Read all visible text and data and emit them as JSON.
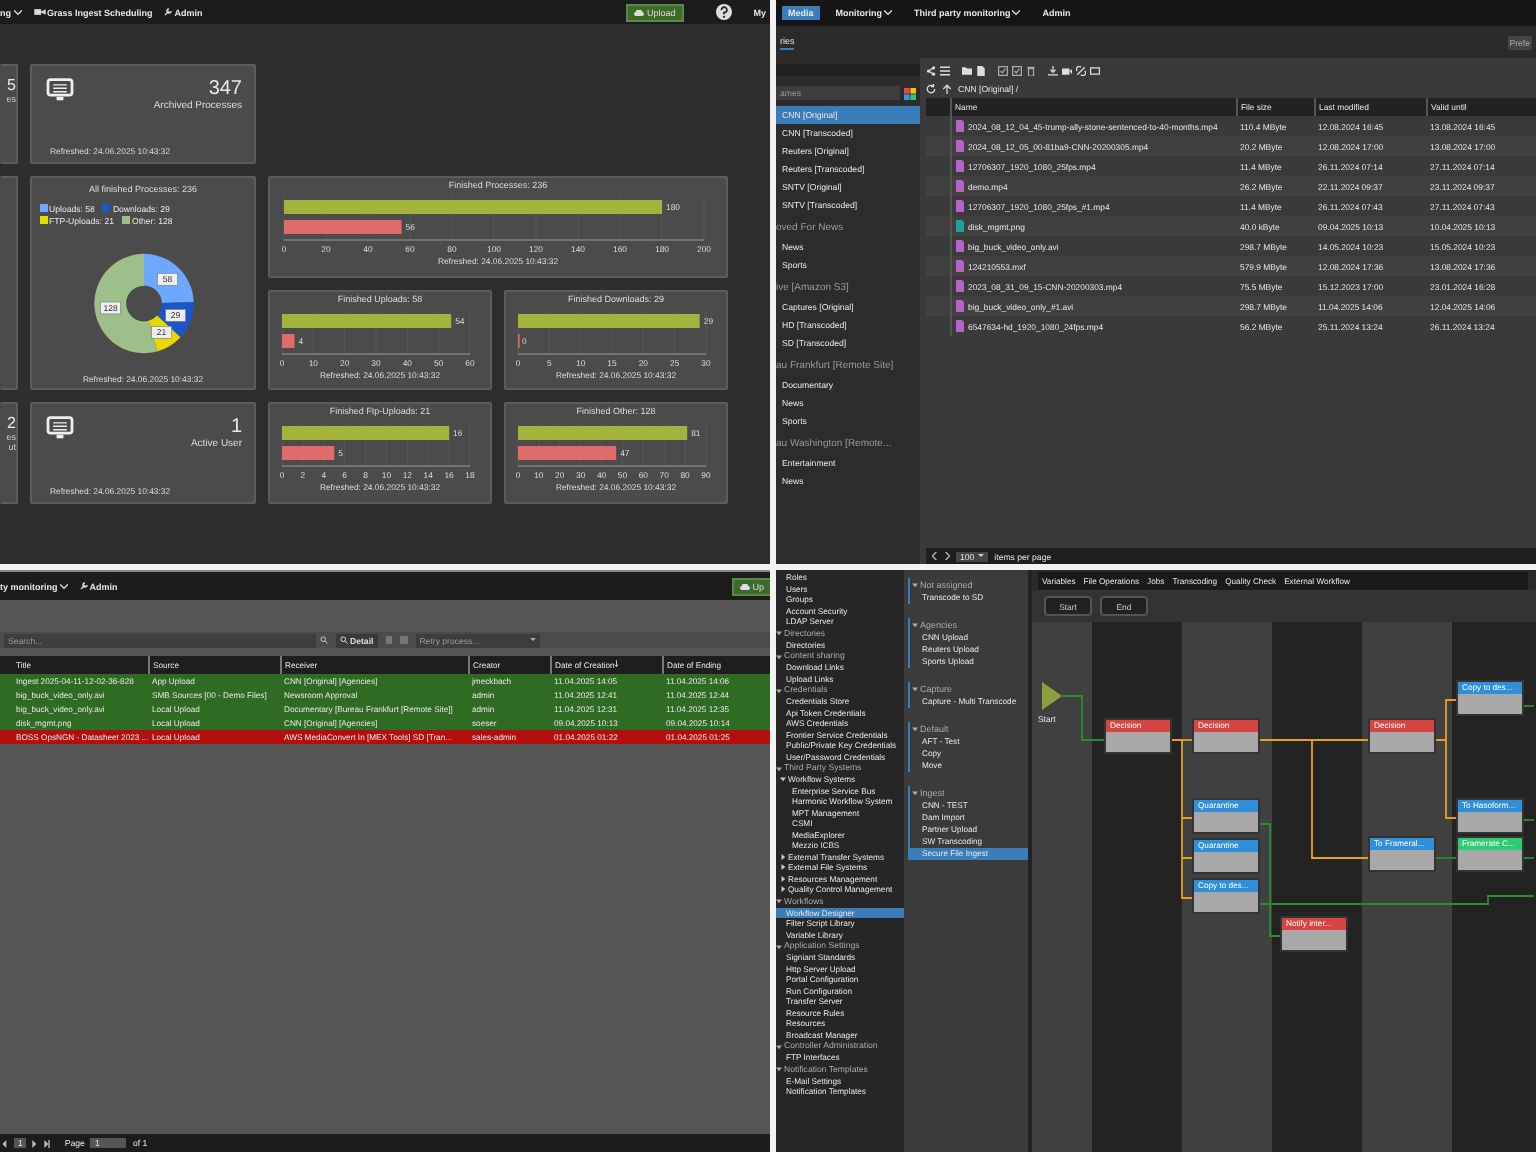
{
  "dashboard": {
    "nav": [
      {
        "label": "ng",
        "caret": true,
        "icon": false
      },
      {
        "label": "Grass Ingest Scheduling",
        "caret": false,
        "icon": true
      },
      {
        "label": "Admin",
        "caret": false,
        "icon": true
      }
    ],
    "upload_button": "Upload",
    "user_menu": "My",
    "partial_cards": [
      {
        "value": "5",
        "label": "es"
      },
      {
        "value": "2",
        "label": "es",
        "extra": "ut"
      }
    ],
    "stat_cards": [
      {
        "value": "347",
        "label": "Archived Processes",
        "refreshed": "Refreshed: 24.06.2025 10:43:32"
      },
      {
        "value": "1",
        "label": "Active User",
        "refreshed": "Refreshed: 24.06.2025 10:43:32"
      }
    ],
    "donut_card": {
      "refreshed": "Refreshed: 24.06.2025 10:43:32",
      "chart_data": {
        "type": "donut",
        "title": "All finished Processes: 236",
        "categories": [
          "Uploads: 58",
          "Downloads: 29",
          "FTP-Uploads: 21",
          "Other: 128"
        ],
        "values": [
          58,
          29,
          21,
          128
        ],
        "colors": [
          "#6ea8fe",
          "#1a56c9",
          "#e6d800",
          "#9dc08b"
        ],
        "data_labels": true
      }
    },
    "bar_cards": [
      {
        "refreshed": "Refreshed: 24.06.2025 10:43:32",
        "chart_data": {
          "type": "bar",
          "orientation": "horizontal",
          "title": "Finished Processes: 236",
          "series": [
            {
              "color": "#a2b23c",
              "values": [
                180
              ]
            },
            {
              "color": "#e06b6b",
              "values": [
                56
              ]
            }
          ],
          "xlim": [
            0,
            200
          ],
          "xticks": [
            0,
            20,
            40,
            60,
            80,
            100,
            120,
            140,
            160,
            180,
            200
          ],
          "grid": true,
          "data_labels": true
        }
      },
      {
        "refreshed": "Refreshed: 24.06.2025 10:43:32",
        "chart_data": {
          "type": "bar",
          "orientation": "horizontal",
          "title": "Finished Uploads: 58",
          "series": [
            {
              "color": "#a2b23c",
              "values": [
                54
              ]
            },
            {
              "color": "#e06b6b",
              "values": [
                4
              ]
            }
          ],
          "xlim": [
            0,
            60
          ],
          "xticks": [
            0,
            10,
            20,
            30,
            40,
            50,
            60
          ],
          "grid": true,
          "data_labels": true
        }
      },
      {
        "refreshed": "Refreshed: 24.06.2025 10:43:32",
        "chart_data": {
          "type": "bar",
          "orientation": "horizontal",
          "title": "Finished Downloads: 29",
          "series": [
            {
              "color": "#a2b23c",
              "values": [
                29
              ]
            },
            {
              "color": "#e06b6b",
              "values": [
                0
              ]
            }
          ],
          "xlim": [
            0,
            30
          ],
          "xticks": [
            0,
            5,
            10,
            15,
            20,
            25,
            30
          ],
          "grid": true,
          "data_labels": true
        }
      },
      {
        "refreshed": "Refreshed: 24.06.2025 10:43:32",
        "chart_data": {
          "type": "bar",
          "orientation": "horizontal",
          "title": "Finished Ftp-Uploads: 21",
          "series": [
            {
              "color": "#a2b23c",
              "values": [
                16
              ]
            },
            {
              "color": "#e06b6b",
              "values": [
                5
              ]
            }
          ],
          "xlim": [
            0,
            18
          ],
          "xticks": [
            0,
            2,
            4,
            6,
            8,
            10,
            12,
            14,
            16,
            18
          ],
          "grid": true,
          "data_labels": true
        }
      },
      {
        "refreshed": "Refreshed: 24.06.2025 10:43:32",
        "chart_data": {
          "type": "bar",
          "orientation": "horizontal",
          "title": "Finished Other: 128",
          "series": [
            {
              "color": "#a2b23c",
              "values": [
                81
              ]
            },
            {
              "color": "#e06b6b",
              "values": [
                47
              ]
            }
          ],
          "xlim": [
            0,
            90
          ],
          "xticks": [
            0,
            10,
            20,
            30,
            40,
            50,
            60,
            70,
            80,
            90
          ],
          "grid": true,
          "data_labels": true
        }
      }
    ]
  },
  "media": {
    "nav": [
      {
        "label": "Media",
        "selected": true,
        "caret": false
      },
      {
        "label": "Monitoring",
        "selected": false,
        "caret": true
      },
      {
        "label": "Third party monitoring",
        "selected": false,
        "caret": true
      },
      {
        "label": "Admin",
        "selected": false,
        "caret": false
      }
    ],
    "section_tab": "ries",
    "section_action": "Prefe",
    "search_placeholder": "ames",
    "groups": [
      {
        "items": [
          {
            "label": "CNN [Original]",
            "selected": true
          },
          {
            "label": "CNN [Transcoded]",
            "selected": false
          },
          {
            "label": "Reuters [Original]",
            "selected": false
          },
          {
            "label": "Reuters [Transcoded]",
            "selected": false
          },
          {
            "label": "SNTV [Original]",
            "selected": false
          },
          {
            "label": "SNTV [Transcoded]",
            "selected": false
          }
        ]
      },
      {
        "title": "oved For News",
        "items": [
          {
            "label": "News",
            "selected": false
          },
          {
            "label": "Sports",
            "selected": false
          }
        ]
      },
      {
        "title": "ive [Amazon S3]",
        "items": [
          {
            "label": "Captures [Original]",
            "selected": false
          },
          {
            "label": "HD [Transcoded]",
            "selected": false
          },
          {
            "label": "SD [Transcoded]",
            "selected": false
          }
        ]
      },
      {
        "title": "au Frankfurt [Remote Site]",
        "items": [
          {
            "label": "Documentary",
            "selected": false
          },
          {
            "label": "News",
            "selected": false
          },
          {
            "label": "Sports",
            "selected": false
          }
        ]
      },
      {
        "title": "au Washington [Remote...",
        "items": [
          {
            "label": "Entertainment",
            "selected": false
          },
          {
            "label": "News",
            "selected": false
          }
        ]
      }
    ],
    "breadcrumb": "CNN [Original] /",
    "columns": [
      "Name",
      "File size",
      "Last modified",
      "Valid until"
    ],
    "rows": [
      {
        "kind": "video",
        "cells": [
          "2024_08_12_04_45-trump-ally-stone-sentenced-to-40-months.mp4",
          "110.4 MByte",
          "12.08.2024 16:45",
          "13.08.2024 16:45"
        ]
      },
      {
        "kind": "video",
        "cells": [
          "2024_08_12_05_00-81ba9-CNN-20200305.mp4",
          "20.2 MByte",
          "12.08.2024 17:00",
          "13.08.2024 17:00"
        ]
      },
      {
        "kind": "video",
        "cells": [
          "12706307_1920_1080_25fps.mp4",
          "11.4 MByte",
          "26.11.2024 07:14",
          "27.11.2024 07:14"
        ]
      },
      {
        "kind": "video",
        "cells": [
          "demo.mp4",
          "26.2 MByte",
          "22.11.2024 09:37",
          "23.11.2024 09:37"
        ]
      },
      {
        "kind": "video",
        "cells": [
          "12706307_1920_1080_25fps_#1.mp4",
          "11.4 MByte",
          "26.11.2024 07:43",
          "27.11.2024 07:43"
        ]
      },
      {
        "kind": "image",
        "cells": [
          "disk_mgmt.png",
          "40.0 kByte",
          "09.04.2025 10:13",
          "10.04.2025 10:13"
        ]
      },
      {
        "kind": "video",
        "cells": [
          "big_buck_video_only.avi",
          "298.7 MByte",
          "14.05.2024 10:23",
          "15.05.2024 10:23"
        ]
      },
      {
        "kind": "video",
        "cells": [
          "124210553.mxf",
          "579.9 MByte",
          "12.08.2024 17:36",
          "13.08.2024 17:36"
        ]
      },
      {
        "kind": "video",
        "cells": [
          "2023_08_31_09_15-CNN-20200303.mp4",
          "75.5 MByte",
          "15.12.2023 17:00",
          "23.01.2024 16:28"
        ]
      },
      {
        "kind": "video",
        "cells": [
          "big_buck_video_only_#1.avi",
          "298.7 MByte",
          "11.04.2025 14:06",
          "12.04.2025 14:06"
        ]
      },
      {
        "kind": "video",
        "cells": [
          "6547634-hd_1920_1080_24fps.mp4",
          "56.2 MByte",
          "25.11.2024 13:24",
          "26.11.2024 13:24"
        ]
      }
    ],
    "page_size": "100",
    "page_size_label": "items per page"
  },
  "processes": {
    "nav": [
      {
        "label": "ty monitoring",
        "caret": true,
        "icon": false
      },
      {
        "label": "Admin",
        "caret": false,
        "icon": true
      }
    ],
    "upload_button": "Up",
    "search_placeholder": "Search...",
    "detail_button": "Detail",
    "retry_placeholder": "Retry process...",
    "columns": [
      {
        "label": "Title",
        "sorted": false
      },
      {
        "label": "Source",
        "sorted": false
      },
      {
        "label": "Receiver",
        "sorted": false
      },
      {
        "label": "Creator",
        "sorted": false
      },
      {
        "label": "Date of Creation",
        "sorted": true
      },
      {
        "label": "Date of Ending",
        "sorted": false
      }
    ],
    "rows": [
      {
        "failed": false,
        "cells": [
          "Ingest 2025-04-11-12-02-36-828",
          "App Upload",
          "CNN [Original] [Agencies]",
          "jmeckbach",
          "11.04.2025 14:05",
          "11.04.2025 14:06"
        ]
      },
      {
        "failed": false,
        "cells": [
          "big_buck_video_only.avi",
          "SMB Sources [00 - Demo Files]",
          "Newsroom Approval",
          "admin",
          "11.04.2025 12:41",
          "11.04.2025 12:44"
        ]
      },
      {
        "failed": false,
        "cells": [
          "big_buck_video_only.avi",
          "Local Upload",
          "Documentary [Bureau Frankfurt [Remote Site]]",
          "admin",
          "11.04.2025 12:31",
          "11.04.2025 12:35"
        ]
      },
      {
        "failed": false,
        "cells": [
          "disk_mgmt.png",
          "Local Upload",
          "CNN [Original] [Agencies]",
          "soeser",
          "09.04.2025 10:13",
          "09.04.2025 10:14"
        ]
      },
      {
        "failed": true,
        "cells": [
          "BOSS OpsNGN - Datasheet 2023 ...",
          "Local Upload",
          "AWS MediaConvert In [MEX Tools] SD [Tran...",
          "sales-admin",
          "01.04.2025 01:22",
          "01.04.2025 01:25"
        ]
      }
    ],
    "pager": {
      "current": "1",
      "page_label": "Page",
      "page_value": "1",
      "of": "of 1"
    }
  },
  "designer": {
    "tree": [
      {
        "children": [
          {
            "label": "Roles"
          },
          {
            "label": "Users"
          },
          {
            "label": "Groups"
          },
          {
            "label": "Account Security"
          },
          {
            "label": "LDAP Server"
          }
        ]
      },
      {
        "label": "Directories",
        "expanded": true,
        "children": [
          {
            "label": "Directories"
          }
        ]
      },
      {
        "label": "Content sharing",
        "expanded": true,
        "children": [
          {
            "label": "Download Links"
          },
          {
            "label": "Upload Links"
          }
        ]
      },
      {
        "label": "Credentials",
        "expanded": true,
        "children": [
          {
            "label": "Credentials Store"
          },
          {
            "label": "Api Token Credentials"
          },
          {
            "label": "AWS Credentials"
          },
          {
            "label": "Frontier Service Credentials"
          },
          {
            "label": "Public/Private Key Credentials"
          },
          {
            "label": "User/Password Credentials"
          }
        ]
      },
      {
        "label": "Third Party Systems",
        "expanded": true,
        "children": [
          {
            "label": "Workflow Systems",
            "expanded": true,
            "children": [
              {
                "label": "Enterprise Service Bus"
              },
              {
                "label": "Harmonic Workflow System"
              },
              {
                "label": "MPT Management"
              },
              {
                "label": "CSMI"
              },
              {
                "label": "MediaExplorer"
              },
              {
                "label": "Mezzio ICBS"
              }
            ]
          },
          {
            "label": "External Transfer Systems",
            "expanded": false
          },
          {
            "label": "External File Systems",
            "expanded": false
          },
          {
            "label": "Resources Management",
            "expanded": false
          },
          {
            "label": "Quality Control Management",
            "expanded": false
          }
        ]
      },
      {
        "label": "Workflows",
        "expanded": true,
        "children": [
          {
            "label": "Workflow Designer",
            "selected": true
          },
          {
            "label": "Filter Script Library",
            "selected": false
          },
          {
            "label": "Variable Library",
            "selected": false
          }
        ]
      },
      {
        "label": "Application Settings",
        "expanded": true,
        "children": [
          {
            "label": "Signiant Standards"
          },
          {
            "label": "Http Server Upload"
          },
          {
            "label": "Portal Configuration"
          },
          {
            "label": "Run Configuration"
          },
          {
            "label": "Transfer Server"
          },
          {
            "label": "Resource Rules"
          },
          {
            "label": "Resources"
          },
          {
            "label": "Broadcast Manager"
          }
        ]
      },
      {
        "label": "Controller Administration",
        "expanded": true,
        "children": [
          {
            "label": "FTP Interfaces"
          }
        ]
      },
      {
        "label": "Notification Templates",
        "expanded": true,
        "children": [
          {
            "label": "E-Mail Settings"
          },
          {
            "label": "Notification Templates"
          }
        ]
      }
    ],
    "workflow_groups": [
      {
        "label": "Not assigned",
        "items": [
          {
            "label": "Transcode to SD",
            "selected": false
          }
        ]
      },
      {
        "label": "Agencies",
        "items": [
          {
            "label": "CNN Upload",
            "selected": false
          },
          {
            "label": "Reuters Upload",
            "selected": false
          },
          {
            "label": "Sports Upload",
            "selected": false
          }
        ]
      },
      {
        "label": "Capture",
        "items": [
          {
            "label": "Capture - Multi Transcode",
            "selected": false
          }
        ]
      },
      {
        "label": "Default",
        "items": [
          {
            "label": "AFT - Test",
            "selected": false
          },
          {
            "label": "Copy",
            "selected": false
          },
          {
            "label": "Move",
            "selected": false
          }
        ]
      },
      {
        "label": "Ingest",
        "items": [
          {
            "label": "CNN - TEST",
            "selected": false
          },
          {
            "label": "Dam Import",
            "selected": false
          },
          {
            "label": "Partner Upload",
            "selected": false
          },
          {
            "label": "SW Transcoding",
            "selected": false
          },
          {
            "label": "Secure File Ingest",
            "selected": true
          }
        ]
      }
    ],
    "tabs": [
      "Variables",
      "File Operations",
      "Jobs",
      "Transcoding",
      "Quality Check",
      "External Workflow"
    ],
    "buttons": [
      "Start",
      "End"
    ],
    "start_label": "Start",
    "nodes": [
      {
        "kind": "decision",
        "title": "Decision"
      },
      {
        "kind": "decision",
        "title": "Decision"
      },
      {
        "kind": "decision",
        "title": "Decision"
      },
      {
        "kind": "task",
        "title": "Copy to des..."
      },
      {
        "kind": "task",
        "title": "Quarantine"
      },
      {
        "kind": "task",
        "title": "Quarantine"
      },
      {
        "kind": "task",
        "title": "Copy to des..."
      },
      {
        "kind": "notify",
        "title": "Notify inter..."
      },
      {
        "kind": "task",
        "title": "To Frameral..."
      },
      {
        "kind": "task",
        "title": "To Hasoform..."
      },
      {
        "kind": "check",
        "title": "Framerate C..."
      }
    ]
  }
}
